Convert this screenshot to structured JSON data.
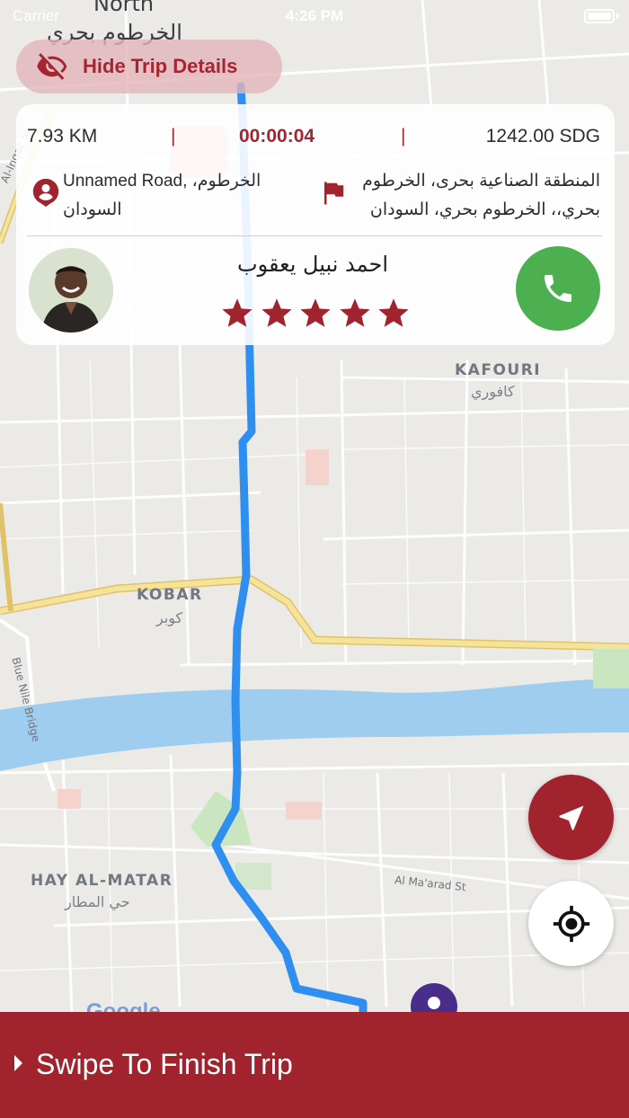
{
  "status_bar": {
    "carrier": "Carrier",
    "time": "4:26 PM"
  },
  "map": {
    "labels": {
      "north": "North",
      "khartoum_bahri_ar": "الخرطوم بحري",
      "kafouri": "KAFOURI",
      "kafouri_ar": "كافوري",
      "kobar": "KOBAR",
      "kobar_ar": "كوبر",
      "hay_al_matar": "HAY AL-MATAR",
      "hay_al_matar_ar": "حي المطار",
      "al_inqaz_st": "Al-Inqaz St",
      "blue_nile_bridge": "Blue Nile Bridge",
      "al_maarad_st": "Al Ma'arad St",
      "google": "Google"
    },
    "route_color": "#2f8ff0",
    "river_color": "#9fcdf0"
  },
  "hide_trip_button": {
    "label": "Hide Trip Details",
    "icon": "eye-off-icon"
  },
  "trip": {
    "distance": "7.93 KM",
    "timer": "00:00:04",
    "fare": "1242.00 SDG",
    "separator": "|",
    "pickup": "Unnamed Road, الخرطوم، السودان",
    "dropoff": "المنطقة الصناعية بحرى، الخرطوم بحري،، الخرطوم بحري، السودان"
  },
  "driver": {
    "name": "احمد نبيل يعقوب",
    "rating": 5,
    "rating_max": 5
  },
  "swipe": {
    "label": "Swipe To Finish Trip"
  },
  "colors": {
    "brand": "#a0232d",
    "call": "#4cb050",
    "route": "#2f8ff0"
  }
}
